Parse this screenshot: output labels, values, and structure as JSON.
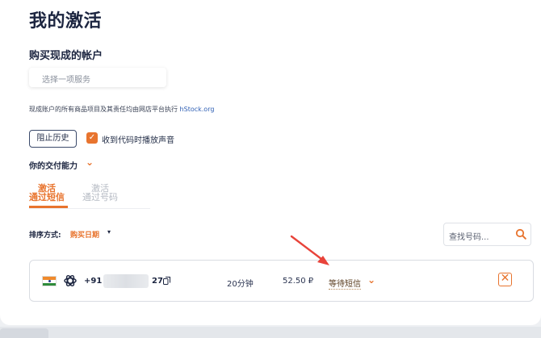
{
  "page": {
    "title": "我的激活",
    "section_title": "购买现成的帐户",
    "service_placeholder": "选择一项服务",
    "notice_text": "现成账户的所有商品项目及其责任均由网店平台执行",
    "notice_link": "hStock.org"
  },
  "controls": {
    "history_button": "阻止历史",
    "sound_checkbox_checked": true,
    "sound_label": "收到代码时播放声音"
  },
  "capability": {
    "label": "你的交付能力",
    "chevron": "⌄"
  },
  "mode_tabs": [
    {
      "line1": "激活",
      "line2": "通过短信",
      "active": true
    },
    {
      "line1": "激活",
      "line2": "通过号码",
      "active": false
    }
  ],
  "sort": {
    "label": "排序方式:",
    "value": "购买日期",
    "caret": "▾"
  },
  "search": {
    "placeholder": "查找号码..."
  },
  "activation": {
    "phone_prefix": "+91 (",
    "phone_suffix": "27",
    "duration": "20分钟",
    "price": "52.50 ₽",
    "status": "等待短信",
    "status_chevron": "⌄",
    "cancel_glyph": "✕"
  },
  "colors": {
    "accent": "#e8742e",
    "text": "#1c2540",
    "muted": "#b5bac3",
    "arrow": "#e8433a"
  },
  "icons": {
    "flag": "india-flag-icon",
    "service": "openai-icon",
    "copy": "copy-icon",
    "search": "search-icon"
  }
}
